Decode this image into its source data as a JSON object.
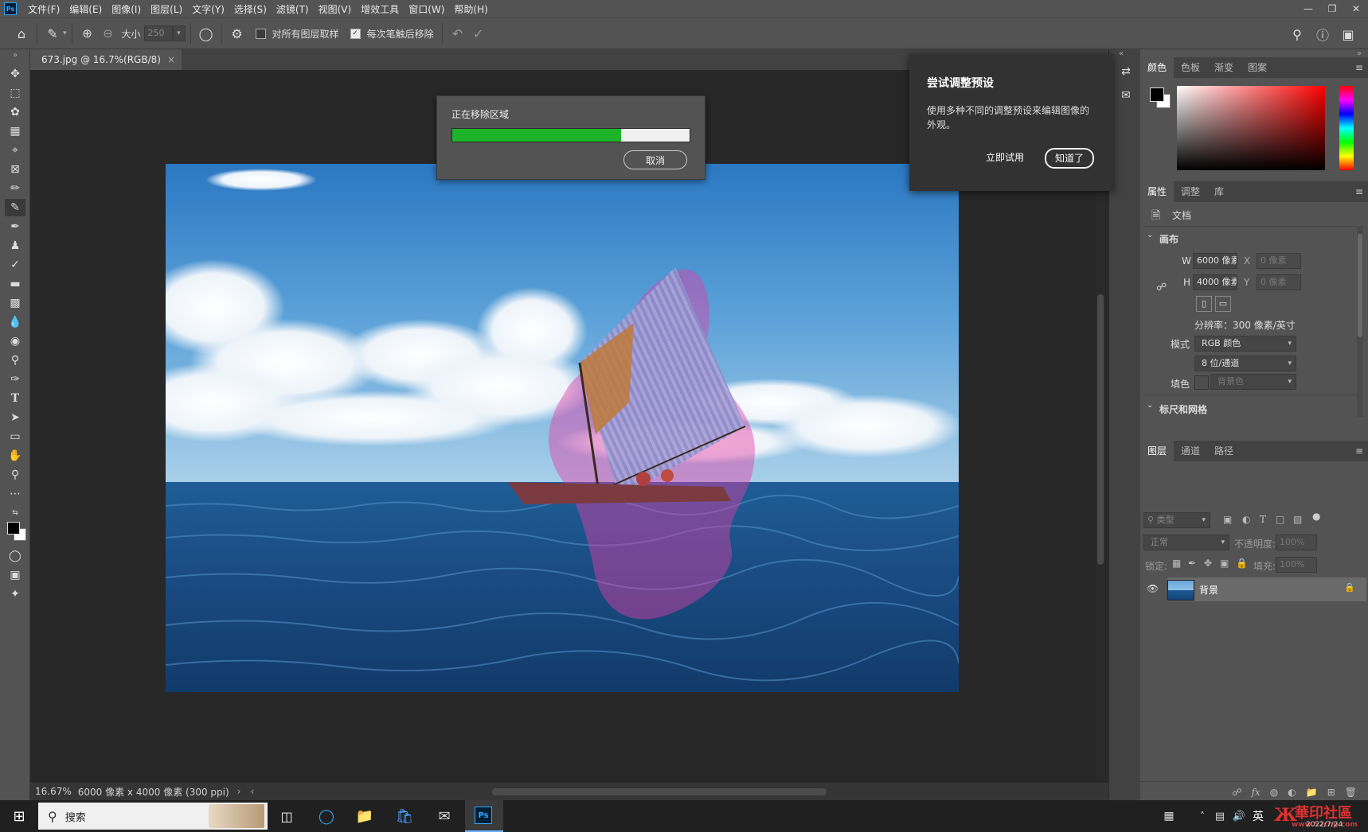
{
  "menubar": {
    "app_icon": "Ps",
    "items": [
      "文件(F)",
      "编辑(E)",
      "图像(I)",
      "图层(L)",
      "文字(Y)",
      "选择(S)",
      "滤镜(T)",
      "视图(V)",
      "增效工具",
      "窗口(W)",
      "帮助(H)"
    ],
    "window_controls": [
      "minimize-icon",
      "restore-icon",
      "close-icon"
    ]
  },
  "options": {
    "size_label": "大小",
    "size_value": "250",
    "sample_all_layers": "对所有图层取样",
    "sample_all_checked": false,
    "remove_after_stroke": "每次笔触后移除",
    "remove_after_checked": true
  },
  "document": {
    "tab_title": "673.jpg @ 16.7%(RGB/8)",
    "tab_close": "×"
  },
  "progress_dialog": {
    "title": "正在移除区域",
    "progress": 0.71,
    "cancel_label": "取消"
  },
  "tip_dialog": {
    "title": "尝试调整预设",
    "body": "使用多种不同的调整预设来编辑图像的外观。",
    "try_label": "立即试用",
    "ok_label": "知道了"
  },
  "color_panel": {
    "tabs": [
      "颜色",
      "色板",
      "渐变",
      "图案"
    ],
    "active_tab": "颜色",
    "foreground": "#000000",
    "background": "#ffffff",
    "hue": "#ff0000"
  },
  "properties_panel": {
    "tabs": [
      "属性",
      "调整",
      "库"
    ],
    "active_tab": "属性",
    "doc_label": "文档",
    "canvas_section": "画布",
    "w_label": "W",
    "w_value": "6000 像素",
    "h_label": "H",
    "h_value": "4000 像素",
    "x_label": "X",
    "x_value": "0 像素",
    "y_label": "Y",
    "y_value": "0 像素",
    "resolution": "分辨率：300 像素/英寸",
    "mode_label": "模式",
    "mode_value": "RGB 颜色",
    "depth_value": "8 位/通道",
    "fill_label": "填色",
    "fill_value": "背景色",
    "rulers_section": "标尺和网格"
  },
  "layers_panel": {
    "tabs": [
      "图层",
      "通道",
      "路径"
    ],
    "active_tab": "图层",
    "filter_placeholder": "类型",
    "blend_mode": "正常",
    "opacity_label": "不透明度:",
    "opacity_value": "100%",
    "lock_label": "锁定:",
    "fill_label": "填充:",
    "fill_value": "100%",
    "layers": [
      {
        "name": "背景",
        "visible": true,
        "locked": true
      }
    ]
  },
  "status": {
    "zoom": "16.67%",
    "doc_size": "6000 像素 x 4000 像素 (300 ppi)"
  },
  "taskbar": {
    "search_placeholder": "搜索",
    "ime": "英",
    "watermark": "華印社區",
    "watermark_url": "www.52cnp.com",
    "date": "2022/7/24"
  }
}
